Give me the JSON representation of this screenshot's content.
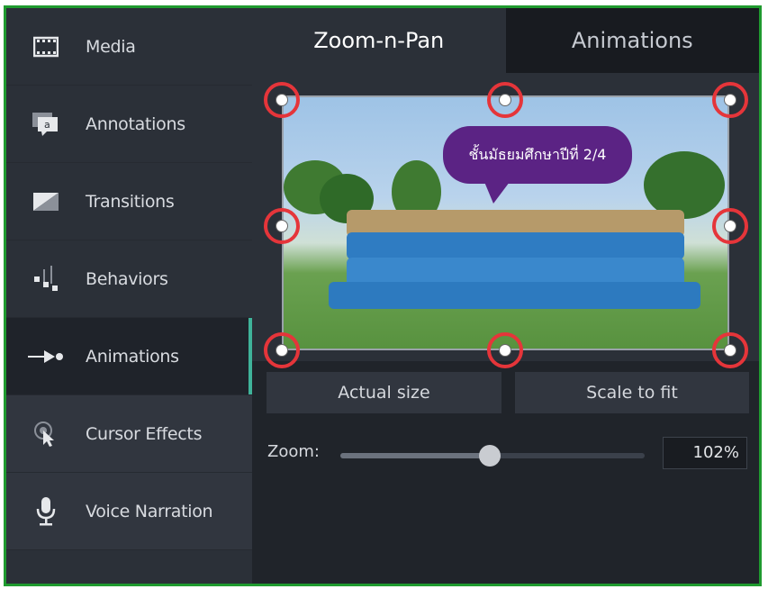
{
  "sidebar": {
    "items": [
      {
        "label": "Media",
        "icon": "film-icon"
      },
      {
        "label": "Annotations",
        "icon": "annotation-icon"
      },
      {
        "label": "Transitions",
        "icon": "transition-icon"
      },
      {
        "label": "Behaviors",
        "icon": "behaviors-icon"
      },
      {
        "label": "Animations",
        "icon": "animation-arrow-icon"
      },
      {
        "label": "Cursor Effects",
        "icon": "cursor-icon"
      },
      {
        "label": "Voice Narration",
        "icon": "microphone-icon"
      }
    ],
    "active_index": 4
  },
  "tabs": [
    {
      "label": "Zoom-n-Pan",
      "active": true
    },
    {
      "label": "Animations",
      "active": false
    }
  ],
  "canvas": {
    "callout_text": "ชั้นมัธยมศึกษาปีที่ 2/4"
  },
  "buttons": {
    "actual_size": "Actual size",
    "scale_to_fit": "Scale to fit"
  },
  "zoom": {
    "label": "Zoom:",
    "value_text": "102%",
    "slider_fraction": 0.49
  },
  "colors": {
    "frame_border": "#1f9a2f",
    "active_accent": "#3fb39a",
    "handle_ring": "#e5353a",
    "callout_bg": "#5b2384"
  }
}
